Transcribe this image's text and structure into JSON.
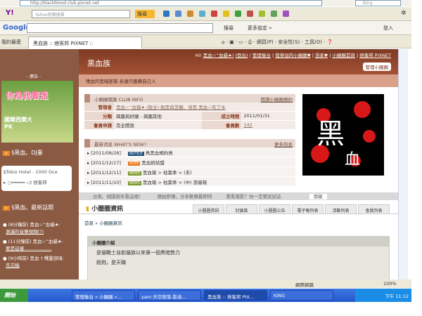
{
  "browser": {
    "url": "http://blackblood.club.pixnet.net",
    "bing_placeholder": "Bing",
    "yahoo_placeholder": "Yahoo奇摩搜尋",
    "yahoo_search": "搜尋",
    "google_search": "搜尋",
    "google_more": "更多設定 »",
    "google_login": "登入",
    "favorites": "我的最愛",
    "tab_title": "黑血族 :: 痞客邦 PIXNET ::",
    "commands": [
      "網頁(P)",
      "安全性(S)",
      "工具(O)"
    ]
  },
  "header": {
    "title": "黑血族",
    "hi": "Hi!",
    "user": "黑血☆”血貓★!",
    "logout": "(登出)",
    "links": [
      "管理後台",
      "我參加的小圈圈▼",
      "語系▼",
      "小圈圈首頁",
      "痞客邦 PIXNET"
    ],
    "manage": "管理小圈圈",
    "subtitle": "嗜血的黑暗部族 永遠只服膺自己人"
  },
  "club_info": {
    "title": "小圈圈檔案 CLUB INFO",
    "rules": "閱讀小圈圈規約",
    "rows": [
      {
        "k": "管理者",
        "v": "黑血☆”血貓★ (版主) 脫黑與芝糖、培思 黑血☆布丁水"
      },
      {
        "k": "分類",
        "v": "興趣與好圈 - 興趣其他",
        "k2": "成立時間",
        "v2": "2011/01/31"
      },
      {
        "k": "會員申請",
        "v": "完全開放",
        "k2": "會員數",
        "v2": "142"
      }
    ]
  },
  "whats_new": {
    "title": "最新消息 WHAT'S NEW?",
    "more": "更多訊息",
    "items": [
      {
        "date": "[2011/08/28]",
        "badge": "NOTICE",
        "color": "#1f4f7a",
        "text": "鳥黑血規約鳥"
      },
      {
        "date": "[2011/12/17]",
        "badge": "VOTE",
        "color": "#e87a1a",
        "text": "黑血統結盟"
      },
      {
        "date": "[2011/12/11]",
        "badge": "NEWS",
        "color": "#7a9a2a",
        "text": "黑血報 > 枯葉季 < (末)"
      },
      {
        "date": "[2011/11/10]",
        "badge": "NEWS",
        "color": "#7a9a2a",
        "text": "黑血報 > 枯葉季 < (中) 旅貓報"
      }
    ]
  },
  "strip": [
    "台南、桃園跨年看這裡！",
    "隨拍即傳，分享歡樂最即時",
    "愛看電影？你一定要試試這",
    "隱藏"
  ],
  "nav": {
    "title": "小圈圈資訊",
    "tabs": [
      "小圈圈資訊",
      "討論區",
      "小圈圈公告",
      "電子報列表",
      "活動列表",
      "會員列表"
    ]
  },
  "breadcrumb": "首頁 » 小圈圈資訊",
  "intro": {
    "title": "小圈圈介紹",
    "lines": [
      "是貓戰士自創貓族以來第一個黑暗勢力",
      "殺戮，是天職"
    ]
  },
  "sidebar": {
    "ad": "- 廣告 -",
    "ad_text": "你為我著迷",
    "ad_sub": "國樂西樂大PK",
    "dj_title": "§黑血。DJ臺",
    "song": "§Tokio Hotel - 1000 Oce",
    "player_brand": "痞客邦",
    "topics_title": "§黑血。最新話題",
    "topics": [
      {
        "meta": "(8分鐘前) 黑血☆”血貓★:",
        "link": "測滿的音樂視頻(?)"
      },
      {
        "meta": "(11分鐘前) 黑血☆”血貓★:",
        "link": "要是這樣..................."
      },
      {
        "meta": "(9小時前) 黑血 † 曙靈部境:",
        "link": "先交稿"
      }
    ]
  },
  "status": {
    "zone": "網際網路",
    "zoom": "100%"
  },
  "taskbar": {
    "start": "開始",
    "items": [
      "管理後台 » 小圈圈 »...",
      "yam 天空部落-影音...",
      "黑血族 :: 痞客邦 PIX...",
      "KING"
    ],
    "clock": "下午 11:12"
  }
}
